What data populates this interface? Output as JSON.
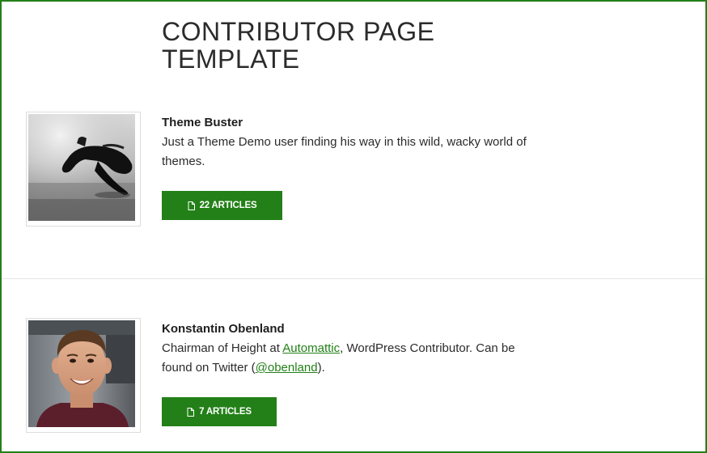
{
  "page": {
    "title": "CONTRIBUTOR PAGE TEMPLATE"
  },
  "contributors": [
    {
      "name": "Theme Buster",
      "bio_text": "Just a Theme Demo user finding his way in this wild, wacky world of themes.",
      "articles_label": "22 ARTICLES",
      "avatar_icon": "sunglasses-photo"
    },
    {
      "name": "Konstantin Obenland",
      "bio_part1": "Chairman of Height at ",
      "bio_link1": "Automattic",
      "bio_part2": ", WordPress Contributor. Can be found on Twitter (",
      "bio_link2": "@obenland",
      "bio_part3": ").",
      "articles_label": "7 ARTICLES",
      "avatar_icon": "portrait-photo"
    }
  ],
  "colors": {
    "accent": "#238018",
    "text": "#2b2b2b",
    "border": "#dcdcdc"
  },
  "icons": {
    "articles": "document-icon"
  }
}
